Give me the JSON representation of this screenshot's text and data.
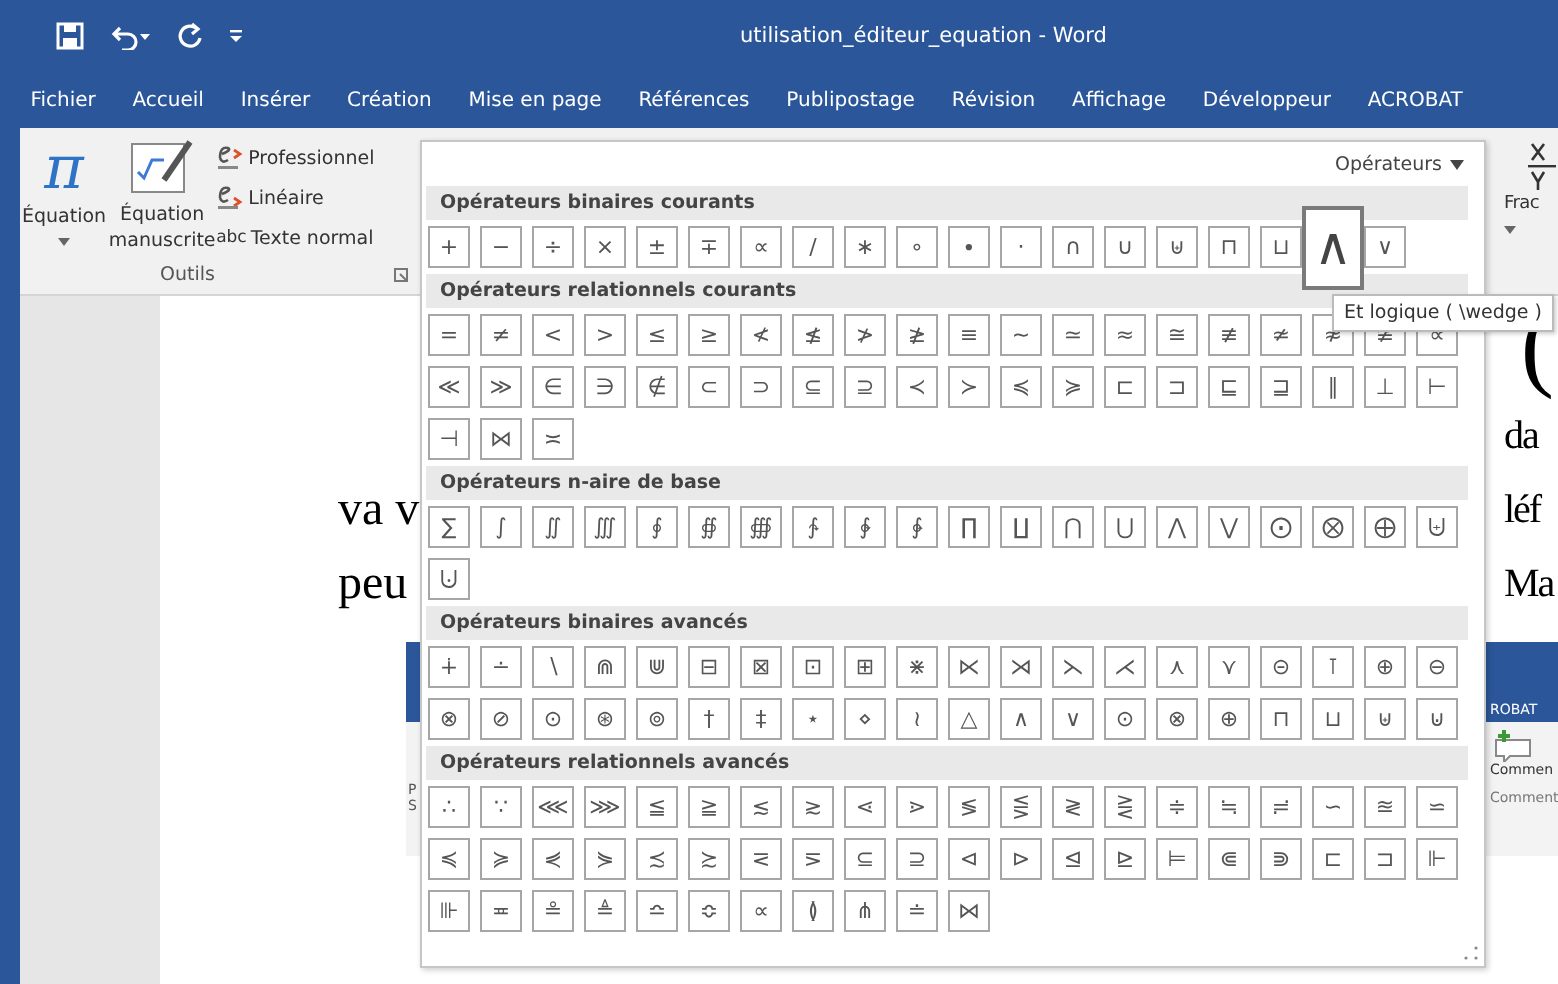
{
  "window": {
    "title": "utilisation_éditeur_equation  -  Word"
  },
  "menu_tabs": [
    "Fichier",
    "Accueil",
    "Insérer",
    "Création",
    "Mise en page",
    "Références",
    "Publipostage",
    "Révision",
    "Affichage",
    "Développeur",
    "ACROBAT"
  ],
  "ribbon": {
    "equation": {
      "icon_char": "π",
      "label": "Équation"
    },
    "ink_equation": {
      "label": "Équation manuscrite"
    },
    "formats": [
      {
        "kind": "professional",
        "label": "Professionnel"
      },
      {
        "kind": "linear",
        "label": "Linéaire"
      },
      {
        "kind": "text",
        "icon_text": "abc",
        "label": "Texte normal"
      }
    ],
    "group_label": "Outils",
    "fraction": {
      "label": "Frac"
    }
  },
  "document": {
    "bracket": "(",
    "lines": [
      {
        "right": "da"
      },
      {
        "left": "va v",
        "right": "léf"
      },
      {
        "left": "peu",
        "right": "Ma"
      }
    ],
    "embedded_screenshot": {
      "left_texts": [
        "P",
        "S"
      ],
      "tab": "ROBAT",
      "button": "Commen",
      "group": "Comment"
    }
  },
  "gallery": {
    "menu": "Opérateurs",
    "tooltip": "Et logique ( \\wedge )",
    "sections": [
      {
        "title": "Opérateurs binaires courants",
        "symbols": [
          {
            "char": "+",
            "hovered": false
          },
          {
            "char": "−",
            "hovered": false
          },
          {
            "char": "÷",
            "hovered": false
          },
          {
            "char": "×",
            "hovered": false
          },
          {
            "char": "±",
            "hovered": false
          },
          {
            "char": "∓",
            "hovered": false
          },
          {
            "char": "∝",
            "hovered": false
          },
          {
            "char": "∕",
            "hovered": false
          },
          {
            "char": "∗",
            "hovered": false
          },
          {
            "char": "∘",
            "hovered": false
          },
          {
            "char": "∙",
            "hovered": false
          },
          {
            "char": "⋅",
            "hovered": false
          },
          {
            "char": "∩",
            "hovered": false
          },
          {
            "char": "∪",
            "hovered": false
          },
          {
            "char": "⊎",
            "hovered": false
          },
          {
            "char": "⊓",
            "hovered": false
          },
          {
            "char": "⊔",
            "hovered": false
          },
          {
            "char": "∧",
            "hovered": true
          },
          {
            "char": "∨",
            "hovered": false
          }
        ]
      },
      {
        "title": "Opérateurs relationnels courants",
        "symbols": [
          "=",
          "≠",
          "<",
          ">",
          "≤",
          "≥",
          "≮",
          "≰",
          "≯",
          "≱",
          "≡",
          "∼",
          "≃",
          "≈",
          "≅",
          "≢",
          "≄",
          "≉",
          "≇",
          "∝",
          "≪",
          "≫",
          "∈",
          "∋",
          "∉",
          "⊂",
          "⊃",
          "⊆",
          "⊇",
          "≺",
          "≻",
          "≼",
          "≽",
          "⊏",
          "⊐",
          "⊑",
          "⊒",
          "∥",
          "⊥",
          "⊢",
          "⊣",
          "⋈",
          "≍"
        ]
      },
      {
        "title": "Opérateurs n-aire de base",
        "symbols": [
          "∑",
          "∫",
          "∬",
          "∭",
          "∮",
          "∯",
          "∰",
          "∱",
          "∲",
          "∳",
          "∏",
          "∐",
          "⋂",
          "⋃",
          "⋀",
          "⋁",
          "⨀",
          "⨂",
          "⨁",
          "⨄",
          "⨃"
        ]
      },
      {
        "title": "Opérateurs binaires avancés",
        "symbols": [
          "∔",
          "∸",
          "∖",
          "⋒",
          "⋓",
          "⊟",
          "⊠",
          "⊡",
          "⊞",
          "⋇",
          "⋉",
          "⋊",
          "⋋",
          "⋌",
          "⋏",
          "⋎",
          "⊝",
          "⊺",
          "⊕",
          "⊖",
          "⊗",
          "⊘",
          "⊙",
          "⊛",
          "⊚",
          "†",
          "‡",
          "⋆",
          "⋄",
          "≀",
          "△",
          "∧",
          "∨",
          "⊙",
          "⊗",
          "⊕",
          "⊓",
          "⊔",
          "⊎",
          "⊍"
        ]
      },
      {
        "title": "Opérateurs relationnels avancés",
        "symbols": [
          "∴",
          "∵",
          "⋘",
          "⋙",
          "≦",
          "≧",
          "≲",
          "≳",
          "⋖",
          "⋗",
          "≶",
          "⋚",
          "≷",
          "⋛",
          "≑",
          "≒",
          "≓",
          "∽",
          "≊",
          "⋍",
          "≼",
          "≽",
          "⋞",
          "⋟",
          "≾",
          "≿",
          "⋜",
          "⋝",
          "⊆",
          "⊇",
          "⊲",
          "⊳",
          "⊴",
          "⊵",
          "⊨",
          "⋐",
          "⋑",
          "⊏",
          "⊐",
          "⊩",
          "⊪",
          "≖",
          "≗",
          "≜",
          "≏",
          "≎",
          "∝",
          "≬",
          "⋔",
          "≐",
          "⋈"
        ]
      }
    ]
  }
}
